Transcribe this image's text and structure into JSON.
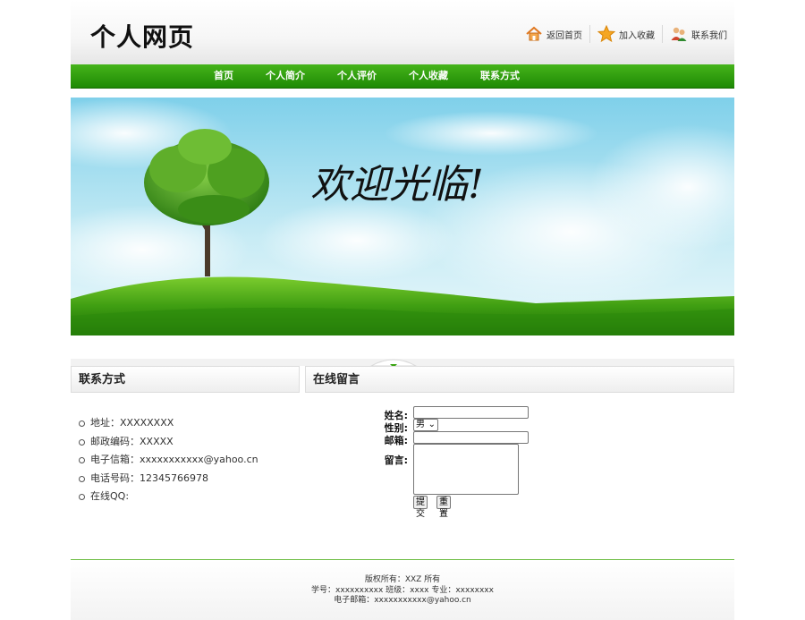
{
  "header": {
    "site_title": "个人网页",
    "links": [
      {
        "label": "返回首页",
        "icon": "home-icon"
      },
      {
        "label": "加入收藏",
        "icon": "star-icon"
      },
      {
        "label": "联系我们",
        "icon": "contacts-icon"
      }
    ]
  },
  "nav": {
    "items": [
      "首页",
      "个人简介",
      "个人评价",
      "个人收藏",
      "联系方式"
    ]
  },
  "banner": {
    "welcome_text": "欢迎光临!"
  },
  "contact_panel": {
    "title": "联系方式",
    "items": [
      "地址：XXXXXXXX",
      "邮政编码：XXXXX",
      "电子信箱：xxxxxxxxxxx@yahoo.cn",
      "电话号码：12345766978",
      "在线QQ:"
    ]
  },
  "message_panel": {
    "title": "在线留言",
    "name_label": "姓名:",
    "gender_label": "性别:",
    "gender_value": "男",
    "email_label": "邮箱:",
    "message_label": "留言:",
    "submit_label": "提交",
    "reset_label": "重置"
  },
  "footer": {
    "line1": "版权所有：XXZ 所有",
    "line2": "学号：xxxxxxxxxx 班级：xxxx 专业：xxxxxxxx",
    "line3": "电子邮箱：xxxxxxxxxxx@yahoo.cn"
  },
  "colors": {
    "nav_green": "#2a9a0c",
    "footer_line": "#6dbd43"
  }
}
